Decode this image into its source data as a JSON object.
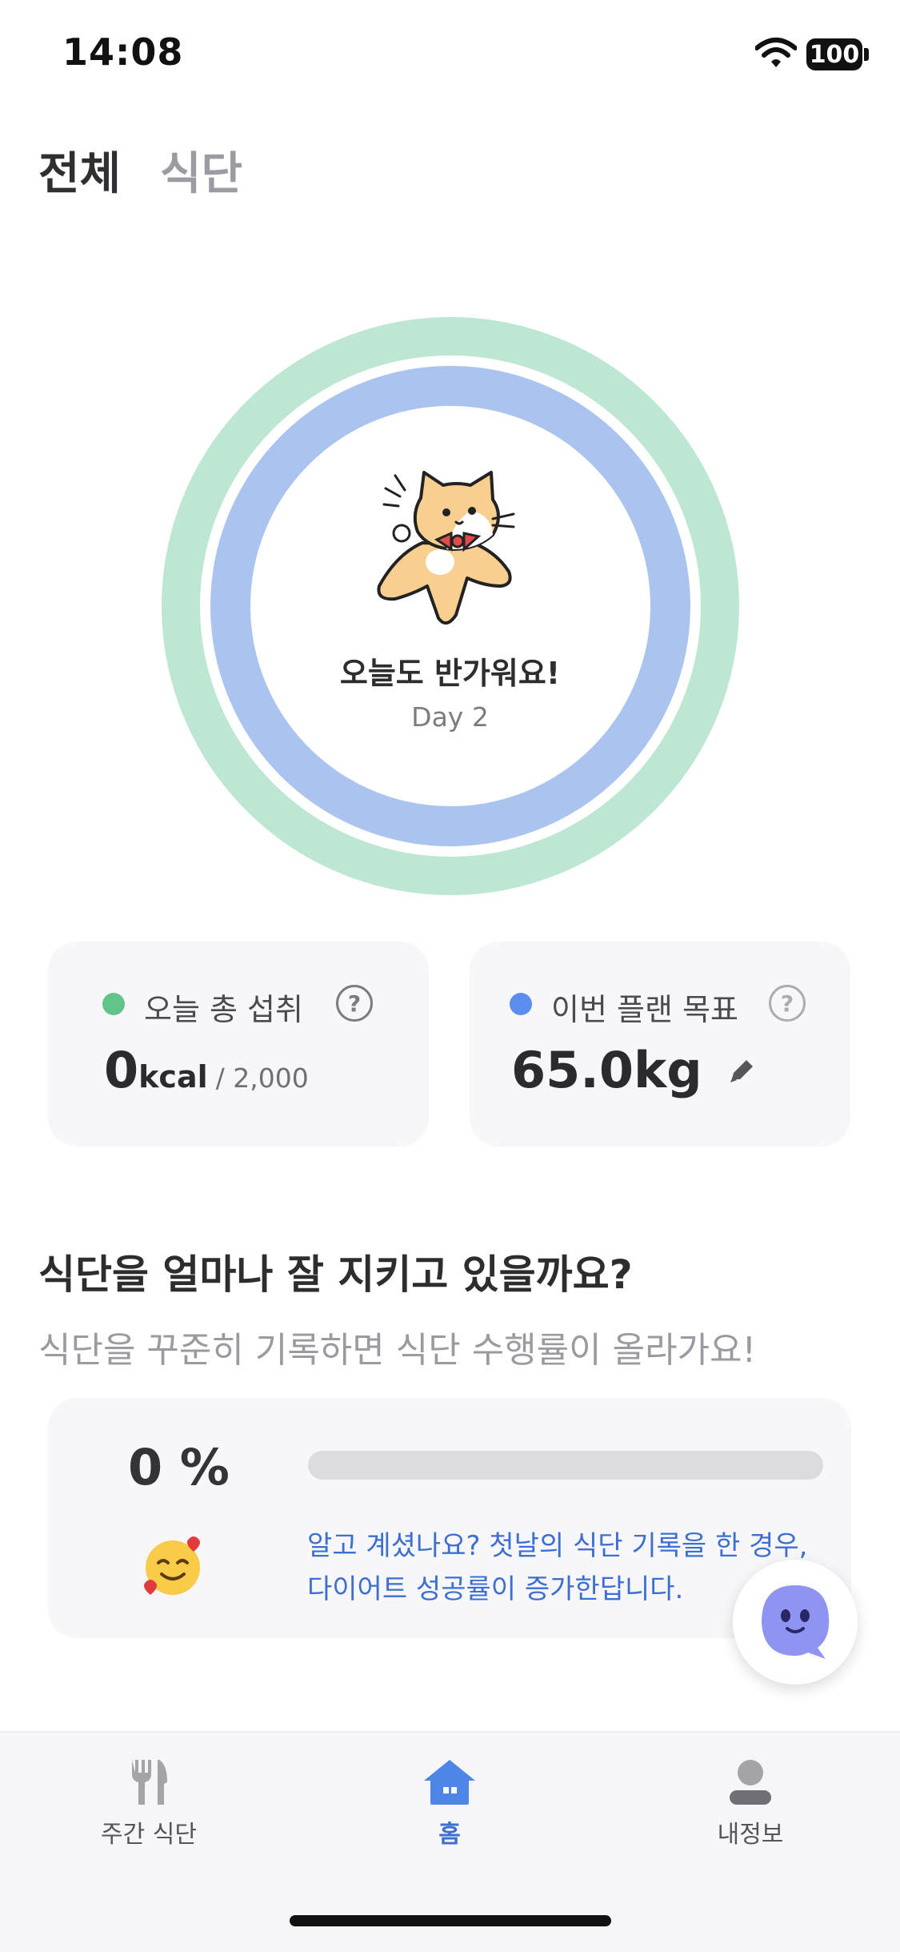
{
  "status_bar": {
    "time": "14:08",
    "battery": "100",
    "icons": [
      "wifi-icon",
      "battery-icon"
    ]
  },
  "tabs": [
    {
      "label": "전체",
      "active": true
    },
    {
      "label": "식단",
      "active": false
    }
  ],
  "hero": {
    "greeting": "오늘도 반가워요!",
    "day": "Day 2",
    "mascot": "cat-mascot",
    "ring_colors": {
      "outer": "#BDE7D3",
      "inner": "#AAC4EF"
    }
  },
  "cards": {
    "intake": {
      "title": "오늘 총 섭취",
      "value": "0",
      "unit": "kcal",
      "goal": "/ 2,000",
      "dot_color": "#63C48A",
      "help_icon": "question-circle-icon"
    },
    "plan": {
      "title": "이번 플랜 목표",
      "value": "65.0kg",
      "dot_color": "#5B8DEF",
      "help_icon": "question-circle-icon",
      "edit_icon": "pencil-icon"
    }
  },
  "adherence": {
    "title": "식단을 얼마나 잘 지키고 있을까요?",
    "subtitle": "식단을 꾸준히 기록하면 식단 수행률이 올라가요!",
    "percent_text": "0 %",
    "percent_value": 0,
    "tip_line1": "알고 계셨나요? 첫날의 식단 기록을 한 경우,",
    "tip_line2": "다이어트 성공률이 증가한답니다.",
    "emoji": "smiling-face-with-hearts-icon",
    "accent": "#3C6FD1"
  },
  "fab": {
    "icon": "chatbot-face-icon"
  },
  "bottom_nav": [
    {
      "label": "주간 식단",
      "icon": "fork-knife-icon",
      "active": false
    },
    {
      "label": "홈",
      "icon": "home-icon",
      "active": true
    },
    {
      "label": "내정보",
      "icon": "user-icon",
      "active": false
    }
  ]
}
